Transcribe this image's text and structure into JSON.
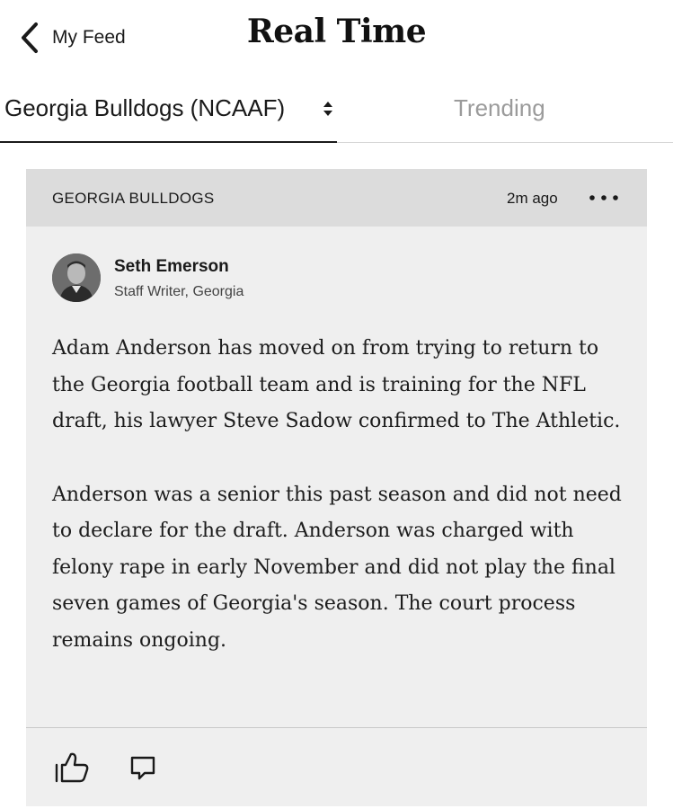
{
  "header": {
    "back_label": "My Feed",
    "title": "Real Time"
  },
  "tabs": {
    "active": "Georgia Bulldogs (NCAAF)",
    "other": "Trending"
  },
  "post": {
    "team": "GEORGIA BULLDOGS",
    "time": "2m ago",
    "author": {
      "name": "Seth Emerson",
      "role": "Staff Writer, Georgia"
    },
    "paragraphs": [
      "Adam Anderson has moved on from trying to return to the Georgia football team and is training for the NFL draft, his lawyer Steve Sadow confirmed to The Athletic.",
      "Anderson was a senior this past season and did not need to declare for the draft. Anderson was charged with felony rape in early November and did not play the final seven games of Georgia's season. The court process remains ongoing."
    ]
  },
  "icons": {
    "back": "chevron-left-icon",
    "sort": "sort-updown-icon",
    "more": "more-horizontal-icon",
    "like": "thumbs-up-icon",
    "comment": "comment-icon"
  },
  "colors": {
    "card_background": "#efefef",
    "card_header": "#dcdcdc",
    "inactive_tab": "#9b9b9b"
  }
}
